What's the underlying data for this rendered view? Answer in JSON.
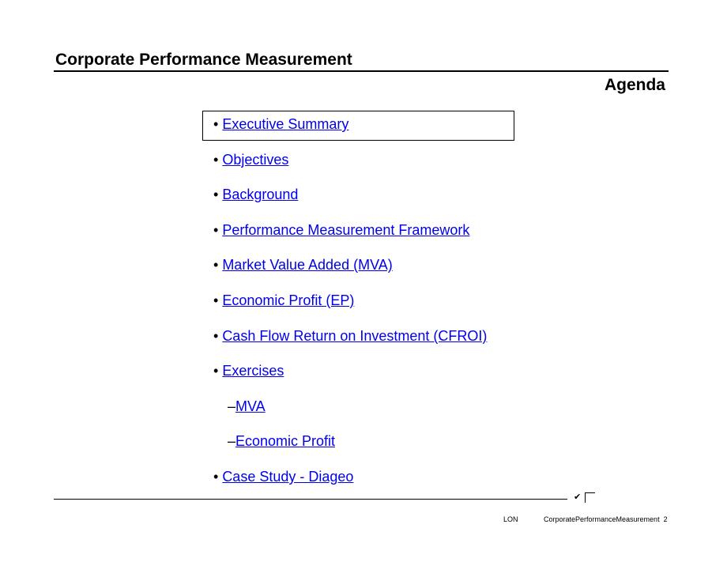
{
  "header": {
    "title": "Corporate Performance Measurement",
    "subtitle": "Agenda"
  },
  "agenda": {
    "items": [
      {
        "prefix": "• ",
        "label": "Executive Summary",
        "highlighted": true
      },
      {
        "prefix": "• ",
        "label": "Objectives"
      },
      {
        "prefix": "• ",
        "label": "Background"
      },
      {
        "prefix": "• ",
        "label": "Performance Measurement Framework"
      },
      {
        "prefix": "• ",
        "label": "Market Value Added (MVA)"
      },
      {
        "prefix": "• ",
        "label": "Economic Profit (EP)"
      },
      {
        "prefix": "• ",
        "label": "Cash Flow Return on Investment (CFROI)"
      },
      {
        "prefix": "• ",
        "label": "Exercises"
      },
      {
        "prefix": "–",
        "label": "MVA"
      },
      {
        "prefix": "–",
        "label": "Economic Profit"
      },
      {
        "prefix": "• ",
        "label": "Case Study - Diageo"
      }
    ]
  },
  "footer": {
    "check_glyph": "✔",
    "office": "LON",
    "document": "CorporatePerformanceMeasurement",
    "page": "2"
  },
  "colors": {
    "link": "#0000ee",
    "text": "#000000"
  }
}
